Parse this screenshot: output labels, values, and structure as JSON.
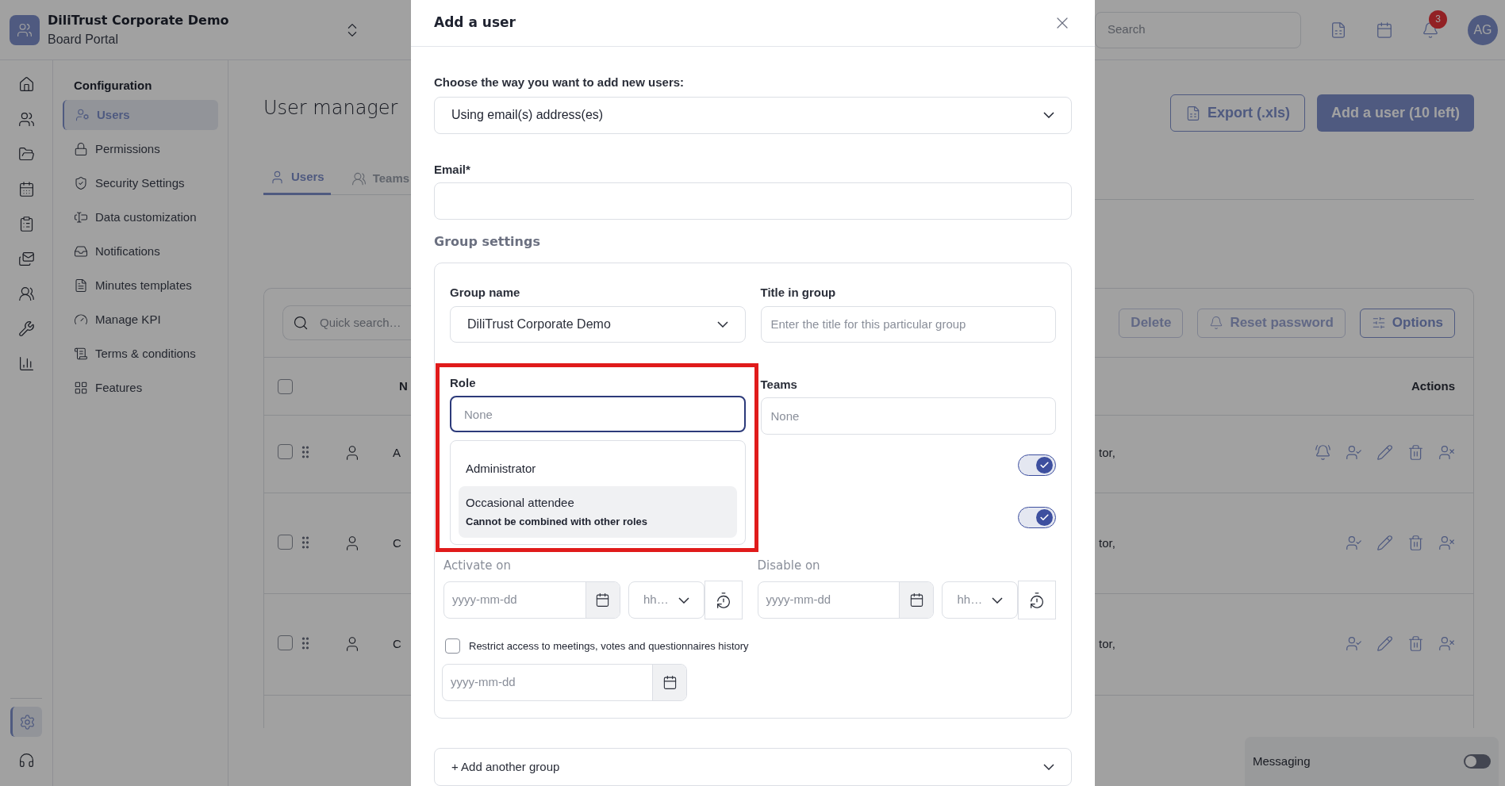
{
  "app": {
    "title": "DiliTrust Corporate Demo",
    "subtitle": "Board Portal"
  },
  "topbar": {
    "search_placeholder": "Search",
    "notification_count": "3",
    "avatar": "AG"
  },
  "rail": [
    {
      "kind": "home"
    },
    {
      "kind": "people"
    },
    {
      "kind": "folder"
    },
    {
      "kind": "calendar"
    },
    {
      "kind": "clipboard"
    },
    {
      "kind": "mail"
    },
    {
      "kind": "group"
    },
    {
      "kind": "tools"
    },
    {
      "kind": "chart"
    }
  ],
  "rail_bottom": [
    {
      "kind": "settings",
      "selected": true
    },
    {
      "kind": "support",
      "selected": false
    }
  ],
  "config": {
    "heading": "Configuration",
    "items": [
      {
        "kind": "users",
        "label": "Users",
        "selected": true
      },
      {
        "kind": "lock",
        "label": "Permissions",
        "selected": false
      },
      {
        "kind": "shield",
        "label": "Security Settings",
        "selected": false
      },
      {
        "kind": "field",
        "label": "Data customization",
        "selected": false
      },
      {
        "kind": "inbox",
        "label": "Notifications",
        "selected": false
      },
      {
        "kind": "template",
        "label": "Minutes templates",
        "selected": false
      },
      {
        "kind": "kpi",
        "label": "Manage KPI",
        "selected": false
      },
      {
        "kind": "terms",
        "label": "Terms & conditions",
        "selected": false
      },
      {
        "kind": "grid",
        "label": "Features",
        "selected": false
      }
    ]
  },
  "page": {
    "title": "User manager",
    "tabs": [
      {
        "label": "Users",
        "selected": true
      },
      {
        "label": "Teams",
        "selected": false
      }
    ],
    "buttons": [
      {
        "label": "Export (.xls)",
        "kind": "outline"
      },
      {
        "label": "Add a user (10 left)",
        "kind": "primary"
      }
    ],
    "table": {
      "search_placeholder": "Quick search…",
      "toolbar": [
        {
          "label": "Delete",
          "disabled": true
        },
        {
          "label": "Reset password",
          "disabled": true
        },
        {
          "label": "Options",
          "disabled": false
        }
      ],
      "columns": {
        "column_2": "N",
        "actions": "Actions"
      },
      "select_all_checked": false,
      "rows": [
        {
          "checked": false,
          "column_2": "A",
          "column_3": "tor,",
          "actions": [
            {
              "kind": "notify"
            },
            {
              "kind": "unlock"
            },
            {
              "kind": "edit"
            },
            {
              "kind": "delete"
            },
            {
              "kind": "block"
            }
          ]
        },
        {
          "checked": false,
          "column_2": "C",
          "column_3": "tor,",
          "actions": [
            {
              "kind": "unlock"
            },
            {
              "kind": "edit"
            },
            {
              "kind": "delete"
            },
            {
              "kind": "block"
            }
          ]
        },
        {
          "checked": false,
          "column_2": "C",
          "column_3": "tor,",
          "actions": [
            {
              "kind": "unlock"
            },
            {
              "kind": "edit"
            },
            {
              "kind": "delete"
            },
            {
              "kind": "block"
            }
          ]
        }
      ]
    }
  },
  "messaging": {
    "label": "Messaging",
    "on": false
  },
  "modal": {
    "title": "Add a user",
    "method": {
      "label": "Choose the way you want to add new users:",
      "value": "Using email(s) address(es)"
    },
    "email": {
      "label": "Email*"
    },
    "group_settings": {
      "title": "Group settings",
      "group_name": {
        "label": "Group name",
        "value": "DiliTrust Corporate Demo"
      },
      "title_in_group": {
        "label": "Title in group",
        "placeholder": "Enter the title for this particular group"
      },
      "role": {
        "label": "Role",
        "placeholder": "None",
        "focused": true,
        "options": [
          {
            "label": "Administrator",
            "highlighted": false
          },
          {
            "label": "Occasional attendee",
            "note": "Cannot be combined with other roles",
            "highlighted": true
          }
        ]
      },
      "teams": {
        "label": "Teams",
        "placeholder": "None"
      },
      "toggles": [
        {
          "on": true
        },
        {
          "on": true
        }
      ],
      "dates": [
        {
          "label": "Activate on",
          "date_placeholder": "yyyy-mm-dd",
          "time_placeholder": "hh…"
        },
        {
          "label": "Disable on",
          "date_placeholder": "yyyy-mm-dd",
          "time_placeholder": "hh…"
        }
      ],
      "restrict": {
        "label": "Restrict access to meetings, votes and questionnaires history",
        "checked": false,
        "date_placeholder": "yyyy-mm-dd"
      }
    },
    "add_group": "+ Add another group"
  }
}
